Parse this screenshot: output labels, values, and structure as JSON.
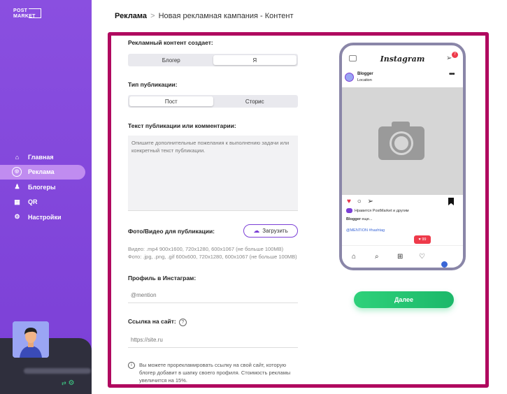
{
  "sidebar": {
    "logo_line1": "POST",
    "logo_line2": "MARKET",
    "nav": [
      {
        "label": "Главная",
        "icon": "home-icon",
        "glyph": "⌂"
      },
      {
        "label": "Реклама",
        "icon": "instagram-icon",
        "glyph": "◎"
      },
      {
        "label": "Блогеры",
        "icon": "people-icon",
        "glyph": "♟"
      },
      {
        "label": "QR",
        "icon": "qr-icon",
        "glyph": "▦"
      },
      {
        "label": "Настройки",
        "icon": "gear-icon",
        "glyph": "⚙"
      }
    ],
    "active_index": 1
  },
  "breadcrumb": {
    "root": "Реклама",
    "separator": ">",
    "current": "Новая рекламная кампания - Контент"
  },
  "form": {
    "creator_label": "Рекламный контент создает:",
    "creator_options": [
      "Блогер",
      "Я"
    ],
    "creator_selected": "Я",
    "pubtype_label": "Тип публикации:",
    "pubtype_options": [
      "Пост",
      "Сторис"
    ],
    "pubtype_selected": "Пост",
    "text_label": "Текст публикации или комментарии:",
    "text_placeholder": "Опишите дополнительные пожелания к выполнению задачи или конкретный текст публикации.",
    "media_label": "Фото/Видео для публикации:",
    "upload_label": "Загрузить",
    "media_hint_video": "Видео: .mp4 900x1600, 720x1280, 600x1067 (не больше 100MB)",
    "media_hint_photo": "Фото: .jpg, .png, .gif 600x600, 720x1280, 600x1067 (не больше 100MB)",
    "instagram_label": "Профиль в Инстаграм:",
    "instagram_placeholder": "@mention",
    "site_label": "Ссылка на сайт:",
    "site_placeholder": "https://site.ru",
    "info_text": "Вы можете прорекламировать ссылку на свой сайт, которую блогер добавит в шапку своего профиля. Стоимость рекламы увеличится на 15%."
  },
  "preview": {
    "app_name": "Instagram",
    "notif_badge": "7",
    "blogger_name": "Blogger",
    "location": "Location",
    "likes_text": "Нравится PostMarket и другим",
    "caption_name": "Blogger",
    "caption_more": "еще...",
    "tags": "@MENTION #hashtag",
    "like_notif": "♥ 99",
    "next_button": "Далее"
  }
}
